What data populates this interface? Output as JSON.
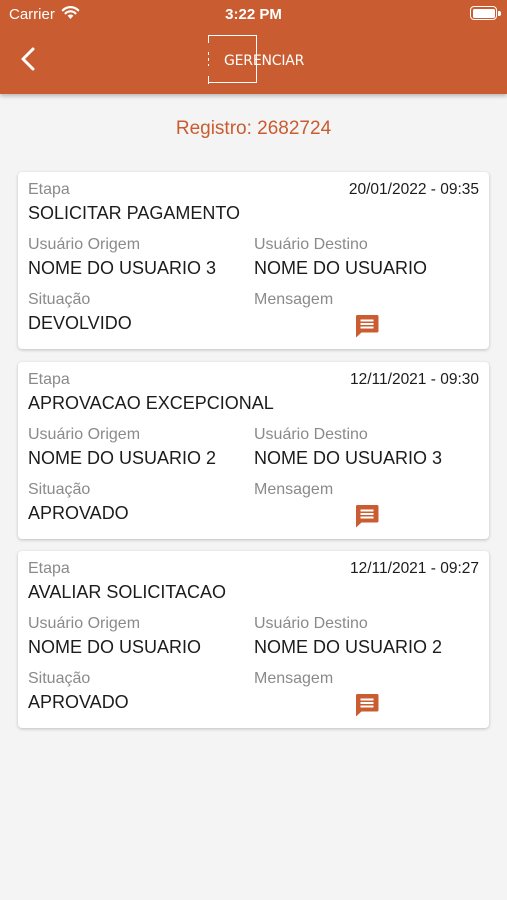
{
  "status_bar": {
    "carrier": "Carrier",
    "time": "3:22 PM"
  },
  "header": {
    "logo_text": "GERENCIAR"
  },
  "registro": "Registro: 2682724",
  "labels": {
    "etapa": "Etapa",
    "usuario_origem": "Usuário Origem",
    "usuario_destino": "Usuário Destino",
    "situacao": "Situação",
    "mensagem": "Mensagem"
  },
  "cards": [
    {
      "datetime": "20/01/2022 - 09:35",
      "etapa": "SOLICITAR PAGAMENTO",
      "usuario_origem": "NOME DO USUARIO 3",
      "usuario_destino": "NOME DO USUARIO",
      "situacao": "DEVOLVIDO"
    },
    {
      "datetime": "12/11/2021 - 09:30",
      "etapa": "APROVACAO EXCEPCIONAL",
      "usuario_origem": "NOME DO USUARIO 2",
      "usuario_destino": "NOME DO USUARIO 3",
      "situacao": "APROVADO"
    },
    {
      "datetime": "12/11/2021 - 09:27",
      "etapa": "AVALIAR SOLICITACAO",
      "usuario_origem": "NOME DO USUARIO",
      "usuario_destino": "NOME DO USUARIO 2",
      "situacao": "APROVADO"
    }
  ],
  "colors": {
    "accent": "#c95c30",
    "background": "#f4f4f4"
  },
  "icons": {
    "back": "chevron-left-icon",
    "wifi": "wifi-icon",
    "battery": "battery-icon",
    "message": "message-icon"
  }
}
